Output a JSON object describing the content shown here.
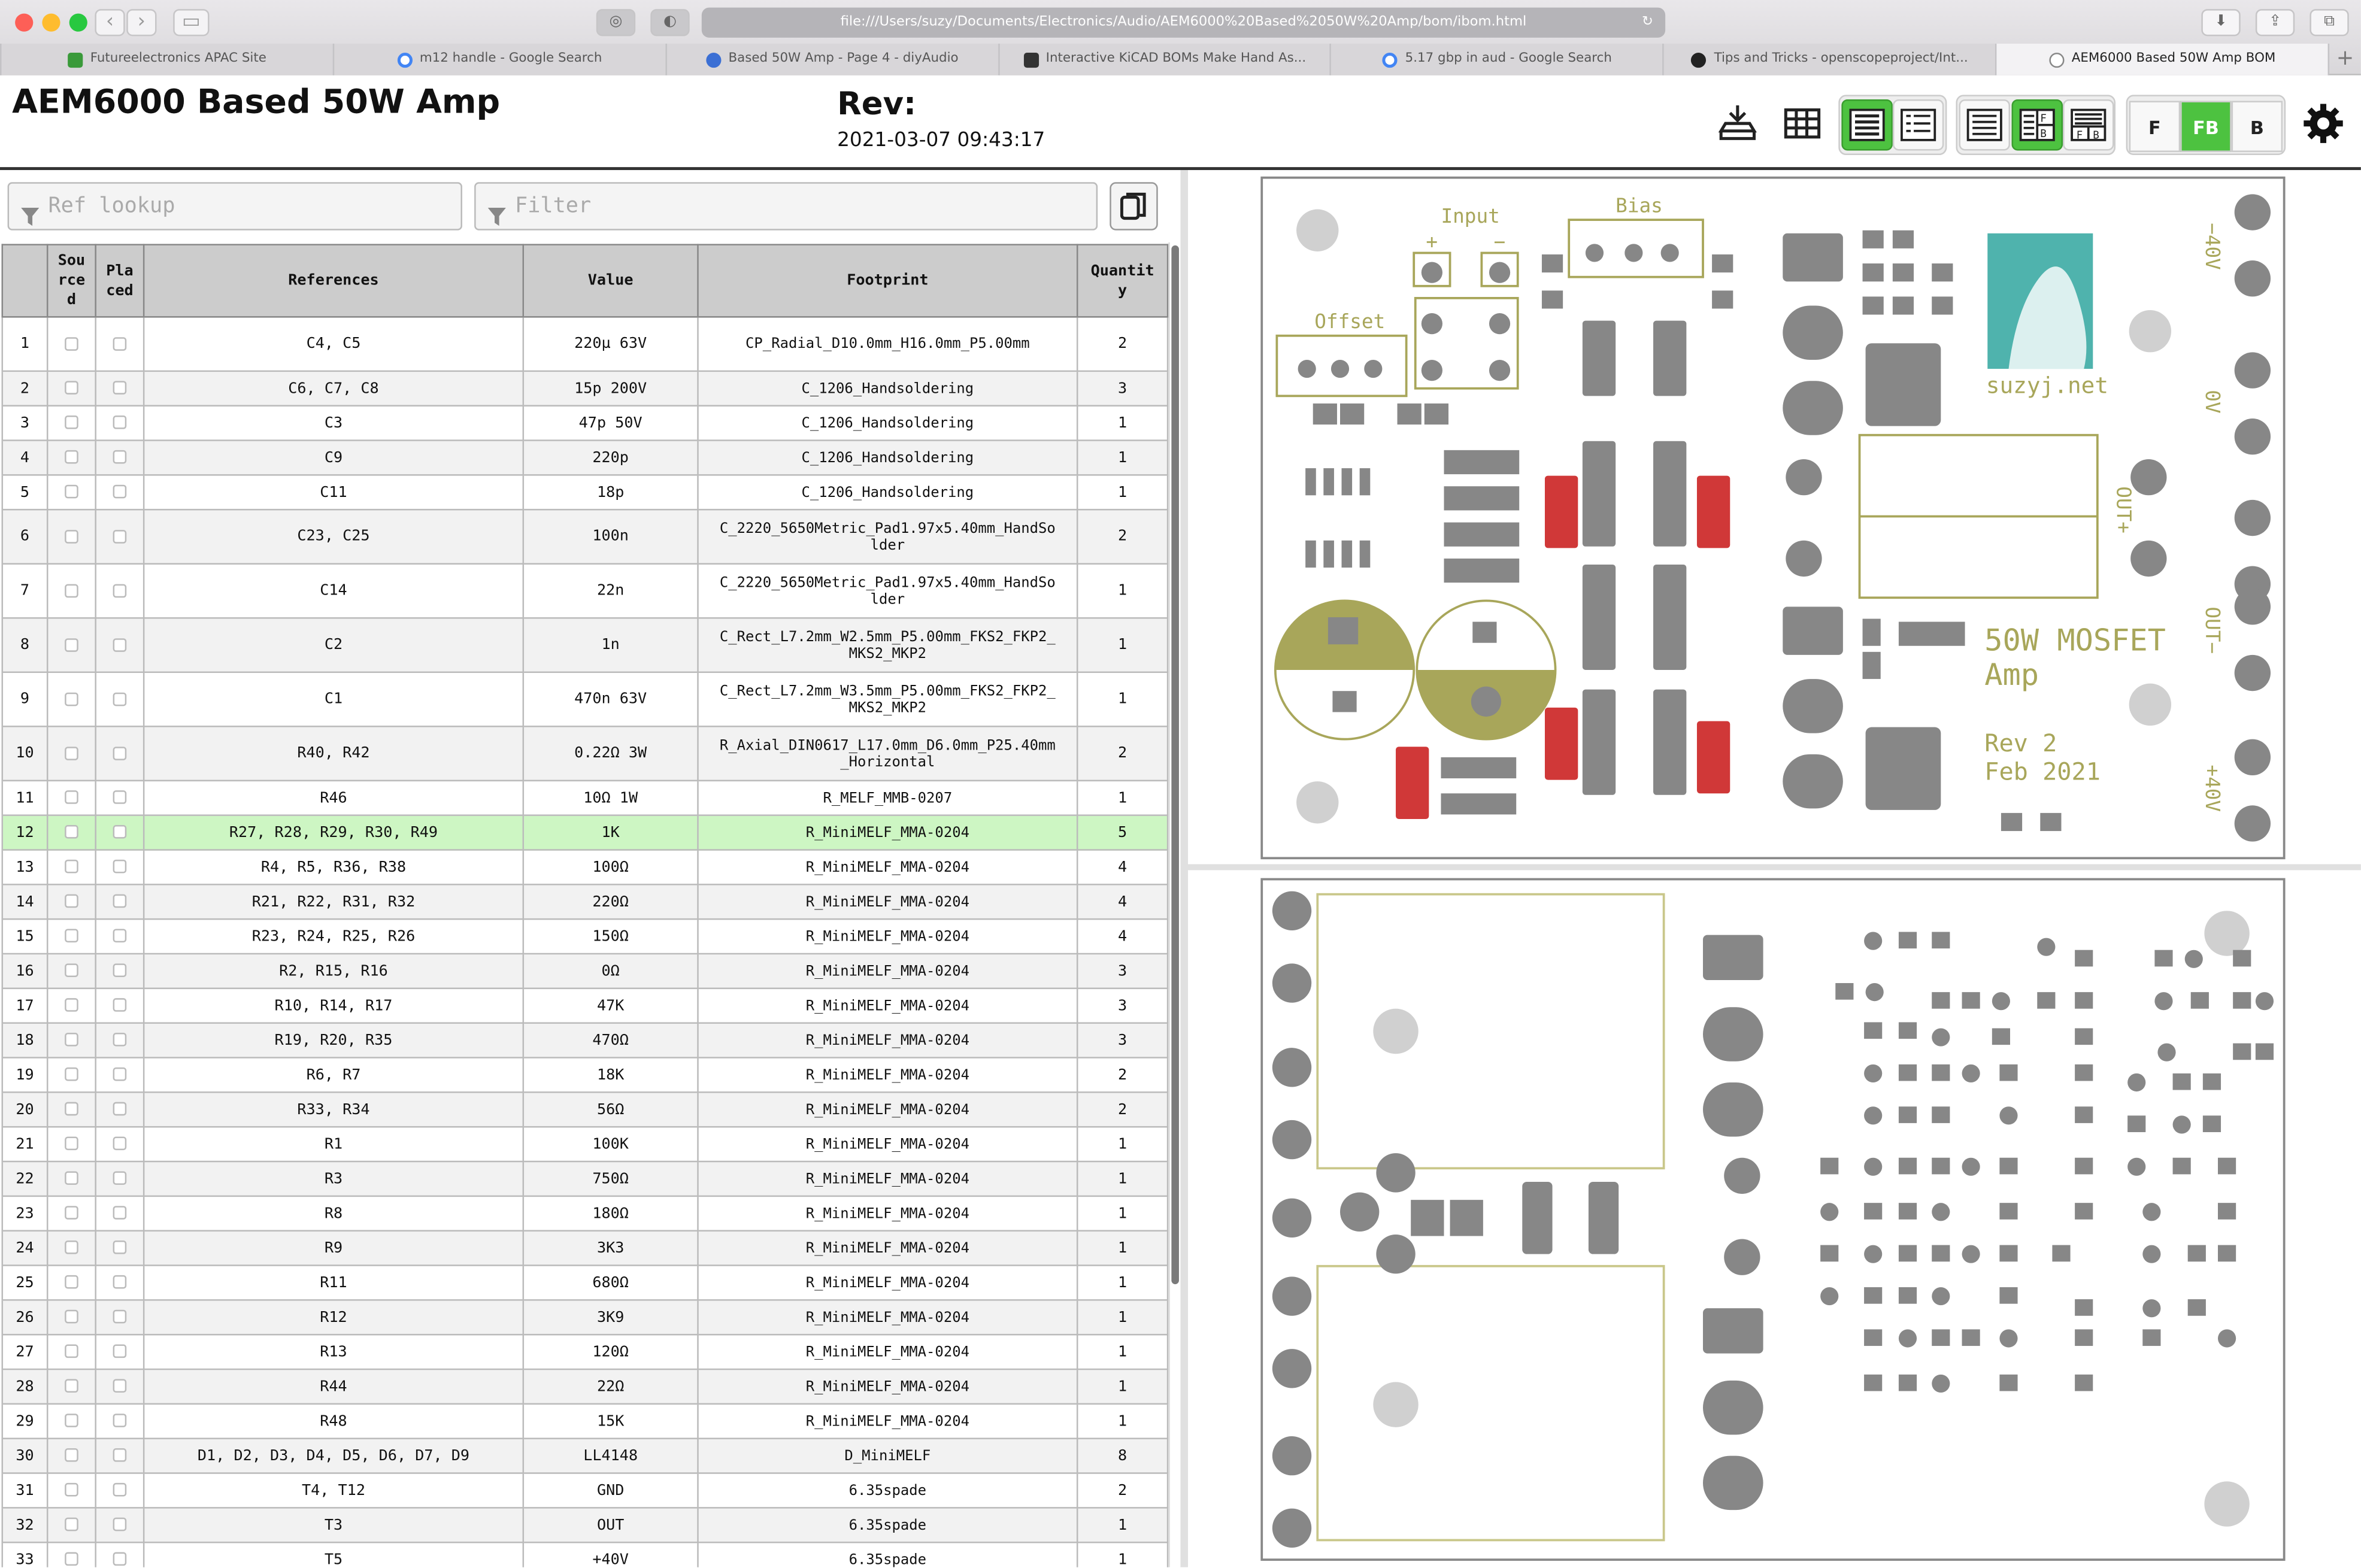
{
  "browser": {
    "url": "file:///Users/suzy/Documents/Electronics/Audio/AEM6000%20Based%2050W%20Amp/bom/ibom.html",
    "tabs": [
      {
        "label": "Futureelectronics APAC Site",
        "icon": "spreadsheet-icon",
        "color": "#3a9a3a"
      },
      {
        "label": "m12 handle - Google Search",
        "icon": "google-icon",
        "color": "#4285f4"
      },
      {
        "label": "Based 50W Amp - Page 4 - diyAudio",
        "icon": "diyaudio-icon",
        "color": "#3b6fd4"
      },
      {
        "label": "Interactive KiCAD BOMs Make Hand As...",
        "icon": "hackaday-icon",
        "color": "#333333"
      },
      {
        "label": "5.17 gbp in aud - Google Search",
        "icon": "google-icon",
        "color": "#4285f4"
      },
      {
        "label": "Tips and Tricks - openscopeproject/Int...",
        "icon": "github-icon",
        "color": "#222222"
      },
      {
        "label": "AEM6000 Based 50W Amp BOM",
        "icon": "page-icon",
        "color": "#888888"
      }
    ]
  },
  "header": {
    "title": "AEM6000 Based 50W Amp",
    "rev_label": "Rev:",
    "rev_date": "2021-03-07 09:43:17",
    "layer_buttons": [
      "F",
      "FB",
      "B"
    ],
    "selected_layer": "FB",
    "accent": "#4dc240"
  },
  "search": {
    "ref_placeholder": "Ref lookup",
    "filter_placeholder": "Filter"
  },
  "table": {
    "columns": [
      "",
      "Sourced",
      "Placed",
      "References",
      "Value",
      "Footprint",
      "Quantity"
    ],
    "column_display": [
      "",
      "Sou\nrce\nd",
      "Pla\nced",
      "References",
      "Value",
      "Footprint",
      "Quantit\ny"
    ],
    "highlighted_row": 12,
    "rows": [
      {
        "n": "1",
        "refs": "C4, C5",
        "value": "220µ 63V",
        "fp": "CP_Radial_D10.0mm_H16.0mm_P5.00mm",
        "qty": "2"
      },
      {
        "n": "2",
        "refs": "C6, C7, C8",
        "value": "15p 200V",
        "fp": "C_1206_Handsoldering",
        "qty": "3"
      },
      {
        "n": "3",
        "refs": "C3",
        "value": "47p 50V",
        "fp": "C_1206_Handsoldering",
        "qty": "1"
      },
      {
        "n": "4",
        "refs": "C9",
        "value": "220p",
        "fp": "C_1206_Handsoldering",
        "qty": "1"
      },
      {
        "n": "5",
        "refs": "C11",
        "value": "18p",
        "fp": "C_1206_Handsoldering",
        "qty": "1"
      },
      {
        "n": "6",
        "refs": "C23, C25",
        "value": "100n",
        "fp": "C_2220_5650Metric_Pad1.97x5.40mm_HandSo lder",
        "qty": "2"
      },
      {
        "n": "7",
        "refs": "C14",
        "value": "22n",
        "fp": "C_2220_5650Metric_Pad1.97x5.40mm_HandSo lder",
        "qty": "1"
      },
      {
        "n": "8",
        "refs": "C2",
        "value": "1n",
        "fp": "C_Rect_L7.2mm_W2.5mm_P5.00mm_FKS2_FKP2_ MKS2_MKP2",
        "qty": "1"
      },
      {
        "n": "9",
        "refs": "C1",
        "value": "470n 63V",
        "fp": "C_Rect_L7.2mm_W3.5mm_P5.00mm_FKS2_FKP2_ MKS2_MKP2",
        "qty": "1"
      },
      {
        "n": "10",
        "refs": "R40, R42",
        "value": "0.22Ω 3W",
        "fp": "R_Axial_DIN0617_L17.0mm_D6.0mm_P25.40mm _Horizontal",
        "qty": "2"
      },
      {
        "n": "11",
        "refs": "R46",
        "value": "10Ω 1W",
        "fp": "R_MELF_MMB-0207",
        "qty": "1"
      },
      {
        "n": "12",
        "refs": "R27, R28, R29, R30, R49",
        "value": "1K",
        "fp": "R_MiniMELF_MMA-0204",
        "qty": "5"
      },
      {
        "n": "13",
        "refs": "R4, R5, R36, R38",
        "value": "100Ω",
        "fp": "R_MiniMELF_MMA-0204",
        "qty": "4"
      },
      {
        "n": "14",
        "refs": "R21, R22, R31, R32",
        "value": "220Ω",
        "fp": "R_MiniMELF_MMA-0204",
        "qty": "4"
      },
      {
        "n": "15",
        "refs": "R23, R24, R25, R26",
        "value": "150Ω",
        "fp": "R_MiniMELF_MMA-0204",
        "qty": "4"
      },
      {
        "n": "16",
        "refs": "R2, R15, R16",
        "value": "0Ω",
        "fp": "R_MiniMELF_MMA-0204",
        "qty": "3"
      },
      {
        "n": "17",
        "refs": "R10, R14, R17",
        "value": "47K",
        "fp": "R_MiniMELF_MMA-0204",
        "qty": "3"
      },
      {
        "n": "18",
        "refs": "R19, R20, R35",
        "value": "470Ω",
        "fp": "R_MiniMELF_MMA-0204",
        "qty": "3"
      },
      {
        "n": "19",
        "refs": "R6, R7",
        "value": "18K",
        "fp": "R_MiniMELF_MMA-0204",
        "qty": "2"
      },
      {
        "n": "20",
        "refs": "R33, R34",
        "value": "56Ω",
        "fp": "R_MiniMELF_MMA-0204",
        "qty": "2"
      },
      {
        "n": "21",
        "refs": "R1",
        "value": "100K",
        "fp": "R_MiniMELF_MMA-0204",
        "qty": "1"
      },
      {
        "n": "22",
        "refs": "R3",
        "value": "750Ω",
        "fp": "R_MiniMELF_MMA-0204",
        "qty": "1"
      },
      {
        "n": "23",
        "refs": "R8",
        "value": "180Ω",
        "fp": "R_MiniMELF_MMA-0204",
        "qty": "1"
      },
      {
        "n": "24",
        "refs": "R9",
        "value": "3K3",
        "fp": "R_MiniMELF_MMA-0204",
        "qty": "1"
      },
      {
        "n": "25",
        "refs": "R11",
        "value": "680Ω",
        "fp": "R_MiniMELF_MMA-0204",
        "qty": "1"
      },
      {
        "n": "26",
        "refs": "R12",
        "value": "3K9",
        "fp": "R_MiniMELF_MMA-0204",
        "qty": "1"
      },
      {
        "n": "27",
        "refs": "R13",
        "value": "120Ω",
        "fp": "R_MiniMELF_MMA-0204",
        "qty": "1"
      },
      {
        "n": "28",
        "refs": "R44",
        "value": "22Ω",
        "fp": "R_MiniMELF_MMA-0204",
        "qty": "1"
      },
      {
        "n": "29",
        "refs": "R48",
        "value": "15K",
        "fp": "R_MiniMELF_MMA-0204",
        "qty": "1"
      },
      {
        "n": "30",
        "refs": "D1, D2, D3, D4, D5, D6, D7, D9",
        "value": "LL4148",
        "fp": "D_MiniMELF",
        "qty": "8"
      },
      {
        "n": "31",
        "refs": "T4, T12",
        "value": "GND",
        "fp": "6.35spade",
        "qty": "2"
      },
      {
        "n": "32",
        "refs": "T3",
        "value": "OUT",
        "fp": "6.35spade",
        "qty": "1"
      },
      {
        "n": "33",
        "refs": "T5",
        "value": "+40V",
        "fp": "6.35spade",
        "qty": "1"
      }
    ]
  },
  "pcb_front": {
    "labels": {
      "input": "Input",
      "bias": "Bias",
      "offset": "Offset",
      "plus": "+",
      "minus": "−",
      "brand": "suzyj.net",
      "title1": "50W MOSFET",
      "title2": "Amp",
      "rev1": "Rev 2",
      "rev2": "Feb 2021",
      "rail_neg": "−40V",
      "gnd": "0V",
      "out_pos": "OUT+",
      "out_neg": "OUT−",
      "rail_pos": "+40V"
    },
    "colors": {
      "silk": "#a8a65a",
      "pad": "#878787",
      "highlight": "#d03838",
      "board": "#ffffff"
    }
  },
  "pcb_back": {
    "colors": {
      "silk": "#c9c78a",
      "pad": "#878787"
    }
  }
}
